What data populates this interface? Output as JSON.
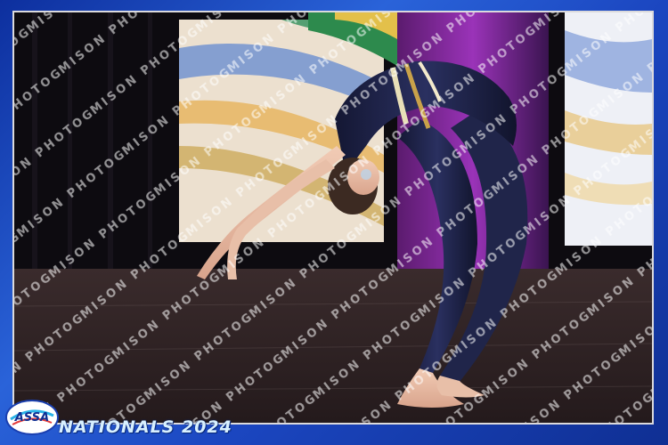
{
  "event": {
    "title": "NATIONALS 2024",
    "logo_text": "ASSA"
  },
  "watermark": {
    "text": "MISON PHOTOGRAPHY"
  },
  "colors": {
    "frame": "#1b46c0",
    "stage_floor": "#2a1f22",
    "leotard": "#1d2140",
    "stripe_gold": "#c9a24a"
  }
}
